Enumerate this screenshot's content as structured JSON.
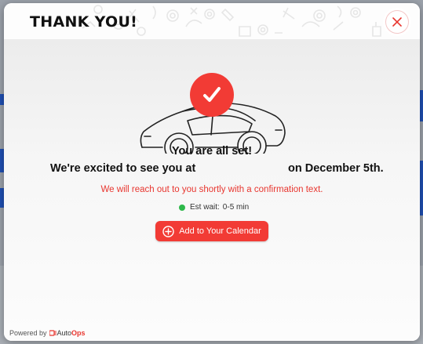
{
  "modal": {
    "title": "THANK YOU!",
    "close_icon": "close-icon"
  },
  "confirmation": {
    "headline": "You are all set!",
    "excited_prefix": "We're excited to see you at",
    "excited_suffix": "on December 5th.",
    "reach_out": "We will reach out to you shortly with a confirmation text.",
    "wait_label": "Est wait:",
    "wait_value": "0-5 min",
    "calendar_button": "Add to Your Calendar"
  },
  "footer": {
    "powered_by": "Powered by",
    "brand_auto": "Auto",
    "brand_ops": "Ops"
  },
  "colors": {
    "accent": "#f23b35",
    "status_green": "#2db84a",
    "backdrop_blue": "#1f4fb3"
  },
  "icons": {
    "check": "checkmark-icon",
    "car": "car-icon",
    "plus": "plus-circle-icon",
    "brand": "autoops-logo-icon"
  }
}
